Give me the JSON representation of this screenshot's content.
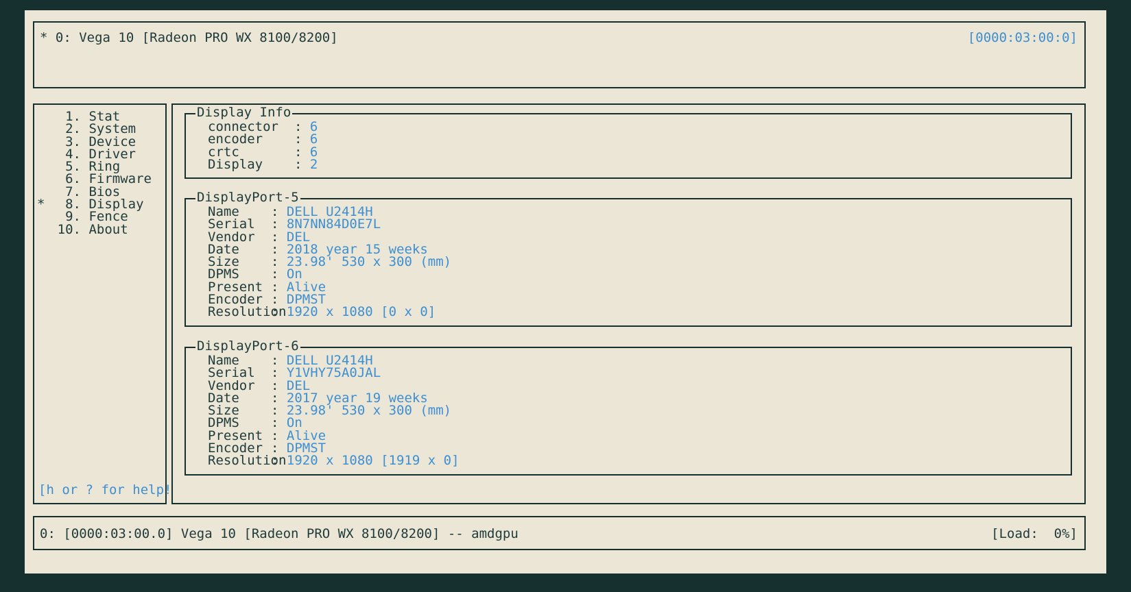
{
  "app": {
    "background_color": "#ece6d6",
    "text_color": "#1e3a3a",
    "value_color": "#3d8fd1",
    "frame_color": "#16302f"
  },
  "header": {
    "gpu_label": "* 0: Vega 10 [Radeon PRO WX 8100/8200]",
    "pci_id": "[0000:03:00:0]"
  },
  "sidebar": {
    "items": [
      {
        "marker": " ",
        "number": "1.",
        "label": "Stat",
        "selected": false
      },
      {
        "marker": " ",
        "number": "2.",
        "label": "System",
        "selected": false
      },
      {
        "marker": " ",
        "number": "3.",
        "label": "Device",
        "selected": false
      },
      {
        "marker": " ",
        "number": "4.",
        "label": "Driver",
        "selected": false
      },
      {
        "marker": " ",
        "number": "5.",
        "label": "Ring",
        "selected": false
      },
      {
        "marker": " ",
        "number": "6.",
        "label": "Firmware",
        "selected": false
      },
      {
        "marker": " ",
        "number": "7.",
        "label": "Bios",
        "selected": false
      },
      {
        "marker": "*",
        "number": "8.",
        "label": "Display",
        "selected": true
      },
      {
        "marker": " ",
        "number": "9.",
        "label": "Fence",
        "selected": false
      },
      {
        "marker": " ",
        "number": "10.",
        "label": "About",
        "selected": false
      }
    ],
    "help_text": "[h or ? for help!]"
  },
  "panels": {
    "display_info": {
      "title": "Display Info",
      "rows": [
        {
          "key": "connector",
          "sep": ":",
          "value": "6"
        },
        {
          "key": "encoder",
          "sep": ":",
          "value": "6"
        },
        {
          "key": "crtc",
          "sep": ":",
          "value": "6"
        },
        {
          "key": "Display",
          "sep": ":",
          "value": "2"
        }
      ]
    },
    "displayport_5": {
      "title": "DisplayPort-5",
      "rows": [
        {
          "key": "Name",
          "sep": ":",
          "value": "DELL U2414H"
        },
        {
          "key": "Serial",
          "sep": ":",
          "value": "8N7NN84D0E7L"
        },
        {
          "key": "Vendor",
          "sep": ":",
          "value": "DEL"
        },
        {
          "key": "Date",
          "sep": ":",
          "value": "2018 year 15 weeks"
        },
        {
          "key": "Size",
          "sep": ":",
          "value": "23.98' 530 x 300 (mm)"
        },
        {
          "key": "DPMS",
          "sep": ":",
          "value": "On"
        },
        {
          "key": "Present",
          "sep": ":",
          "value": "Alive"
        },
        {
          "key": "Encoder",
          "sep": ":",
          "value": "DPMST"
        },
        {
          "key": "Resolution",
          "sep": ":",
          "value": "1920 x 1080 [0 x 0]"
        }
      ]
    },
    "displayport_6": {
      "title": "DisplayPort-6",
      "rows": [
        {
          "key": "Name",
          "sep": ":",
          "value": "DELL U2414H"
        },
        {
          "key": "Serial",
          "sep": ":",
          "value": "Y1VHY75A0JAL"
        },
        {
          "key": "Vendor",
          "sep": ":",
          "value": "DEL"
        },
        {
          "key": "Date",
          "sep": ":",
          "value": "2017 year 19 weeks"
        },
        {
          "key": "Size",
          "sep": ":",
          "value": "23.98' 530 x 300 (mm)"
        },
        {
          "key": "DPMS",
          "sep": ":",
          "value": "On"
        },
        {
          "key": "Present",
          "sep": ":",
          "value": "Alive"
        },
        {
          "key": "Encoder",
          "sep": ":",
          "value": "DPMST"
        },
        {
          "key": "Resolution",
          "sep": ":",
          "value": "1920 x 1080 [1919 x 0]"
        }
      ]
    }
  },
  "footer": {
    "device_line": "0: [0000:03:00.0] Vega 10 [Radeon PRO WX 8100/8200] -- amdgpu",
    "load": "[Load:  0%]"
  }
}
